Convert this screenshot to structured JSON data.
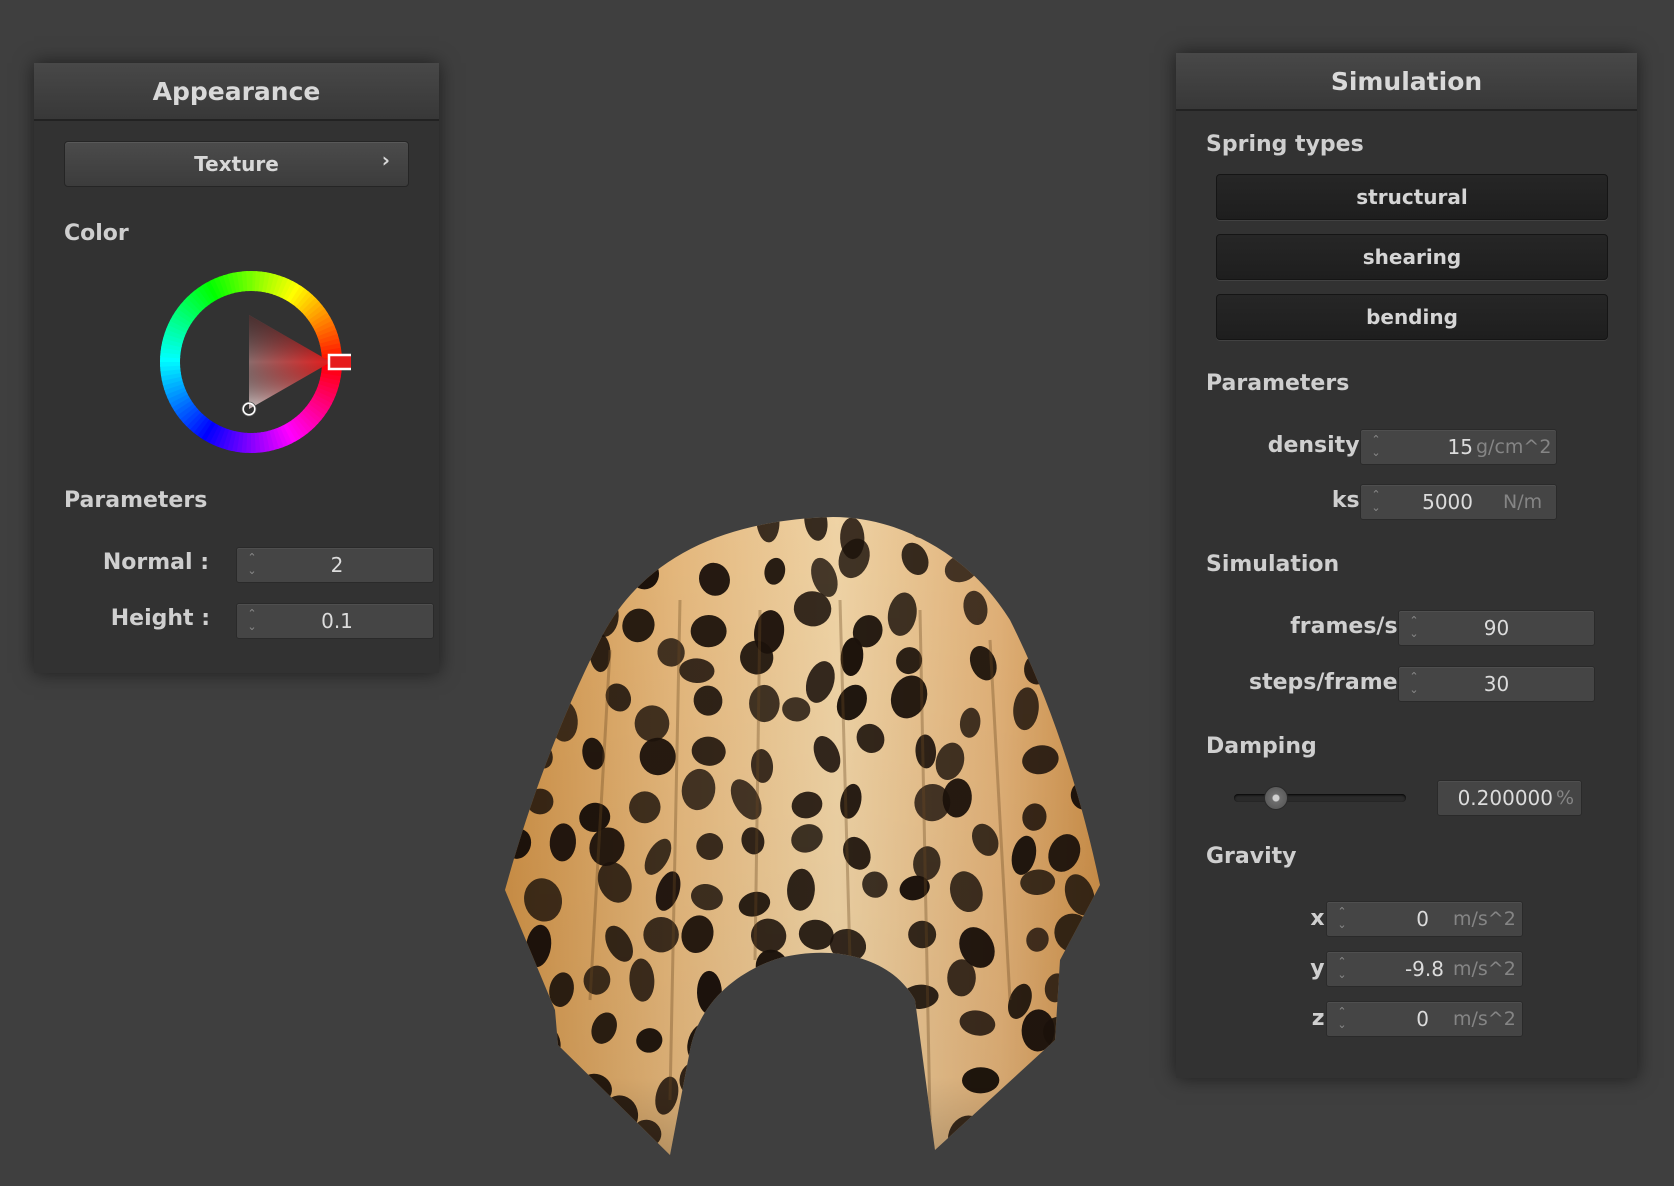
{
  "appearance": {
    "title": "Appearance",
    "texture_button": "Texture",
    "texture_chevron": "›",
    "color_label": "Color",
    "selected_color": "#e61c1c",
    "parameters_label": "Parameters",
    "normal_label": "Normal :",
    "normal_value": "2",
    "height_label": "Height :",
    "height_value": "0.1"
  },
  "simulation": {
    "title": "Simulation",
    "spring_types_label": "Spring types",
    "spring_buttons": [
      "structural",
      "shearing",
      "bending"
    ],
    "parameters_label": "Parameters",
    "density_label": "density :",
    "density_value": "15",
    "density_unit": "g/cm^2",
    "ks_label": "ks :",
    "ks_value": "5000",
    "ks_unit": "N/m",
    "simulation_label": "Simulation",
    "fps_label": "frames/s :",
    "fps_value": "90",
    "steps_label": "steps/frame :",
    "steps_value": "30",
    "damping_label": "Damping",
    "damping_slider_fraction": 0.2,
    "damping_value": "0.200000",
    "damping_unit": "%",
    "gravity_label": "Gravity",
    "gx_label": "x :",
    "gx_value": "0",
    "gy_label": "y :",
    "gy_value": "-9.8",
    "gz_label": "z :",
    "gz_value": "0",
    "gravity_unit": "m/s^2"
  },
  "viewport": {
    "object": "leopard-print cloth draped over sphere",
    "background_color": "#3f3f3f"
  }
}
